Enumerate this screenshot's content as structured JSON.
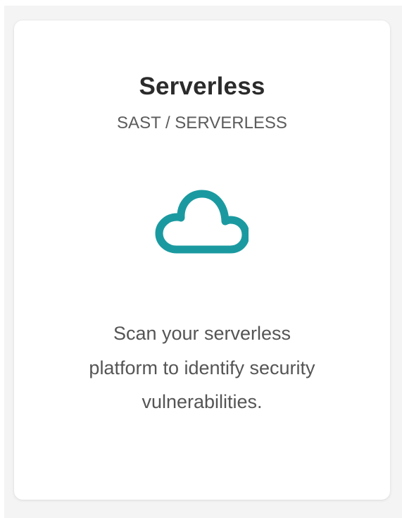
{
  "card": {
    "title": "Serverless",
    "subtitle": "SAST / SERVERLESS",
    "icon": "cloud-icon",
    "description": "Scan your serverless platform to identify security vulnerabilities."
  },
  "colors": {
    "accent": "#1a9aa0",
    "title": "#2b2b2b",
    "subtitle": "#5c5c5c",
    "description": "#555555",
    "background": "#f4f4f5"
  }
}
